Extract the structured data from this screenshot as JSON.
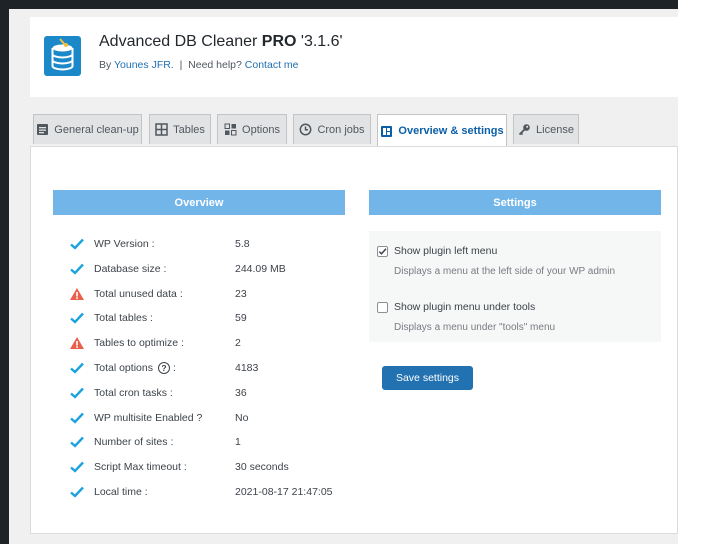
{
  "header": {
    "app_name": "Advanced DB Cleaner",
    "edition": "PRO",
    "version": "'3.1.6'",
    "by_prefix": "By",
    "author": "Younes JFR.",
    "separator": "|",
    "help_prefix": "Need help?",
    "contact_link": "Contact me"
  },
  "tabs": [
    {
      "label": "General clean-up",
      "icon": "broom-doc-icon",
      "active": false
    },
    {
      "label": "Tables",
      "icon": "table-grid-icon",
      "active": false
    },
    {
      "label": "Options",
      "icon": "options-grid-icon",
      "active": false
    },
    {
      "label": "Cron jobs",
      "icon": "clock-icon",
      "active": false
    },
    {
      "label": "Overview & settings",
      "icon": "dashboard-icon",
      "active": true
    },
    {
      "label": "License",
      "icon": "key-icon",
      "active": false
    }
  ],
  "overview": {
    "title": "Overview",
    "rows": [
      {
        "label": "WP Version :",
        "value": "5.8",
        "status": "ok"
      },
      {
        "label": "Database size :",
        "value": "244.09 MB",
        "status": "ok"
      },
      {
        "label": "Total unused data :",
        "value": "23",
        "status": "warning"
      },
      {
        "label": "Total tables :",
        "value": "59",
        "status": "ok"
      },
      {
        "label": "Tables to optimize :",
        "value": "2",
        "status": "warning"
      },
      {
        "label": "Total options",
        "label_suffix": ":",
        "value": "4183",
        "status": "ok",
        "help_icon": "?"
      },
      {
        "label": "Total cron tasks :",
        "value": "36",
        "status": "ok"
      },
      {
        "label": "WP multisite Enabled ?",
        "value": "No",
        "status": "ok"
      },
      {
        "label": "Number of sites :",
        "value": "1",
        "status": "ok"
      },
      {
        "label": "Script Max timeout :",
        "value": "30 seconds",
        "status": "ok"
      },
      {
        "label": "Local time :",
        "value": "2021-08-17 21:47:05",
        "status": "ok"
      }
    ]
  },
  "settings": {
    "title": "Settings",
    "options": [
      {
        "label": "Show plugin left menu",
        "description": "Displays a menu at the left side of your WP admin",
        "checked": true
      },
      {
        "label": "Show plugin menu under tools",
        "description": "Displays a menu under \"tools\" menu",
        "checked": false
      }
    ],
    "save_label": "Save settings"
  },
  "colors": {
    "accent": "#72b5e9",
    "button": "#2271b1",
    "ok_check": "#1aa3dd",
    "warning": "#e8604c",
    "active_tab_text": "#0b5ea8"
  }
}
